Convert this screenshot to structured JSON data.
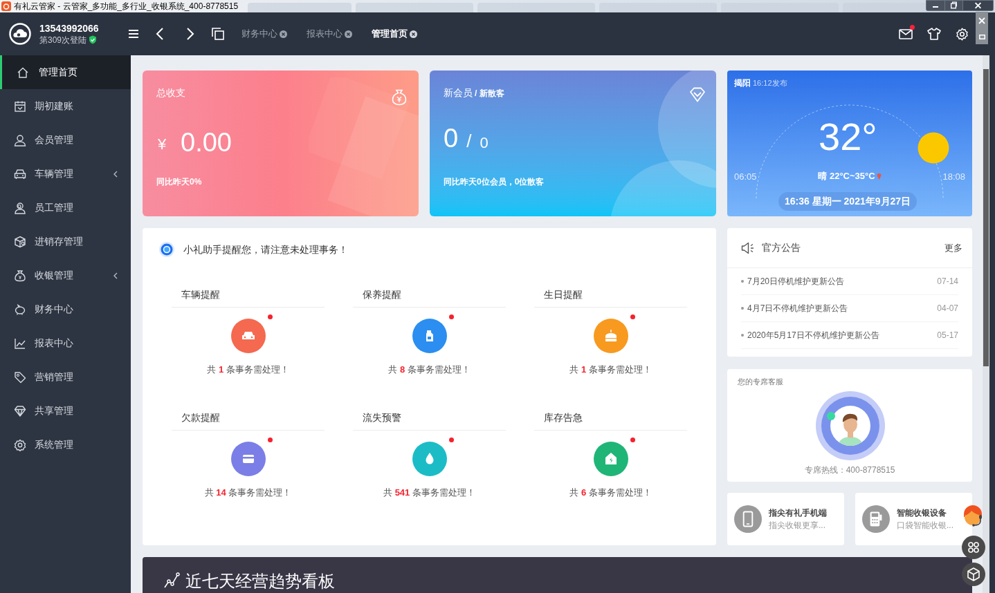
{
  "window": {
    "title": "有礼云管家 - 云管家_多功能_多行业_收银系统_400-8778515"
  },
  "user": {
    "phone": "13543992066",
    "login_count": "第309次登陆"
  },
  "tabs": [
    {
      "label": "财务中心",
      "selected": false
    },
    {
      "label": "报表中心",
      "selected": false
    },
    {
      "label": "管理首页",
      "selected": true
    }
  ],
  "mail_unread": true,
  "sidebar": {
    "items": [
      {
        "label": "管理首页",
        "kind": "home",
        "selected": true,
        "expandable": false
      },
      {
        "label": "期初建账",
        "kind": "calendar",
        "selected": false,
        "expandable": false
      },
      {
        "label": "会员管理",
        "kind": "user",
        "selected": false,
        "expandable": false
      },
      {
        "label": "车辆管理",
        "kind": "car",
        "selected": false,
        "expandable": true
      },
      {
        "label": "员工管理",
        "kind": "staff",
        "selected": false,
        "expandable": false
      },
      {
        "label": "进销存管理",
        "kind": "box",
        "selected": false,
        "expandable": false
      },
      {
        "label": "收银管理",
        "kind": "moneybag",
        "selected": false,
        "expandable": true
      },
      {
        "label": "财务中心",
        "kind": "piggy",
        "selected": false,
        "expandable": false
      },
      {
        "label": "报表中心",
        "kind": "chart",
        "selected": false,
        "expandable": false
      },
      {
        "label": "营销管理",
        "kind": "tag",
        "selected": false,
        "expandable": false
      },
      {
        "label": "共享管理",
        "kind": "diamond",
        "selected": false,
        "expandable": false
      },
      {
        "label": "系统管理",
        "kind": "gear",
        "selected": false,
        "expandable": false
      }
    ]
  },
  "stats": {
    "income": {
      "title": "总收支",
      "currency": "¥",
      "value": "0.00",
      "compare": "同比昨天0%"
    },
    "members": {
      "title": "新会员",
      "subtitle": "/ 新散客",
      "members": "0",
      "separator": "/",
      "walk_ins": "0",
      "compare": "同比昨天0位会员，0位散客"
    }
  },
  "weather": {
    "city": "揭阳",
    "published": "16:12发布",
    "temperature": "32°",
    "condition": "晴 22°C~35°C",
    "sunrise": "06:05",
    "sunset": "18:08",
    "datetime": "16:36 星期一 2021年9月27日"
  },
  "reminders": {
    "title": "小礼助手提醒您，请注意未处理事务！",
    "items": [
      {
        "title": "车辆提醒",
        "kind": "car",
        "color": "#f4694f",
        "unread": true,
        "prefix": "共",
        "count": "1",
        "suffix": "条事务需处理！"
      },
      {
        "title": "保养提醒",
        "kind": "oil",
        "color": "#2b8ef0",
        "unread": true,
        "prefix": "共",
        "count": "8",
        "suffix": "条事务需处理！"
      },
      {
        "title": "生日提醒",
        "kind": "cake",
        "color": "#f79a1f",
        "unread": true,
        "prefix": "共",
        "count": "1",
        "suffix": "条事务需处理！"
      },
      {
        "title": "欠款提醒",
        "kind": "card",
        "color": "#7a7ee6",
        "unread": true,
        "prefix": "共",
        "count": "14",
        "suffix": "条事务需处理！"
      },
      {
        "title": "流失预警",
        "kind": "drop",
        "color": "#1bbcc6",
        "unread": true,
        "prefix": "共",
        "count": "541",
        "suffix": "条事务需处理！"
      },
      {
        "title": "库存告急",
        "kind": "house",
        "color": "#1fb577",
        "unread": true,
        "prefix": "共",
        "count": "6",
        "suffix": "条事务需处理！"
      }
    ]
  },
  "announcements": {
    "title": "官方公告",
    "more": "更多",
    "items": [
      {
        "text": "7月20日停机维护更新公告",
        "date": "07-14"
      },
      {
        "text": "4月7日不停机维护更新公告",
        "date": "04-07"
      },
      {
        "text": "2020年5月17日不停机维护更新公告",
        "date": "05-17"
      }
    ]
  },
  "service": {
    "title": "您的专席客服",
    "online": true,
    "hotline": "专席热线：400-8778515"
  },
  "promos": [
    {
      "title": "指尖有礼手机端",
      "subtitle": "指尖收银更享...",
      "kind": "phone"
    },
    {
      "title": "智能收银设备",
      "subtitle": "口袋智能收银...",
      "kind": "pos"
    }
  ],
  "trend_panel": {
    "title": "近七天经营趋势看板"
  }
}
